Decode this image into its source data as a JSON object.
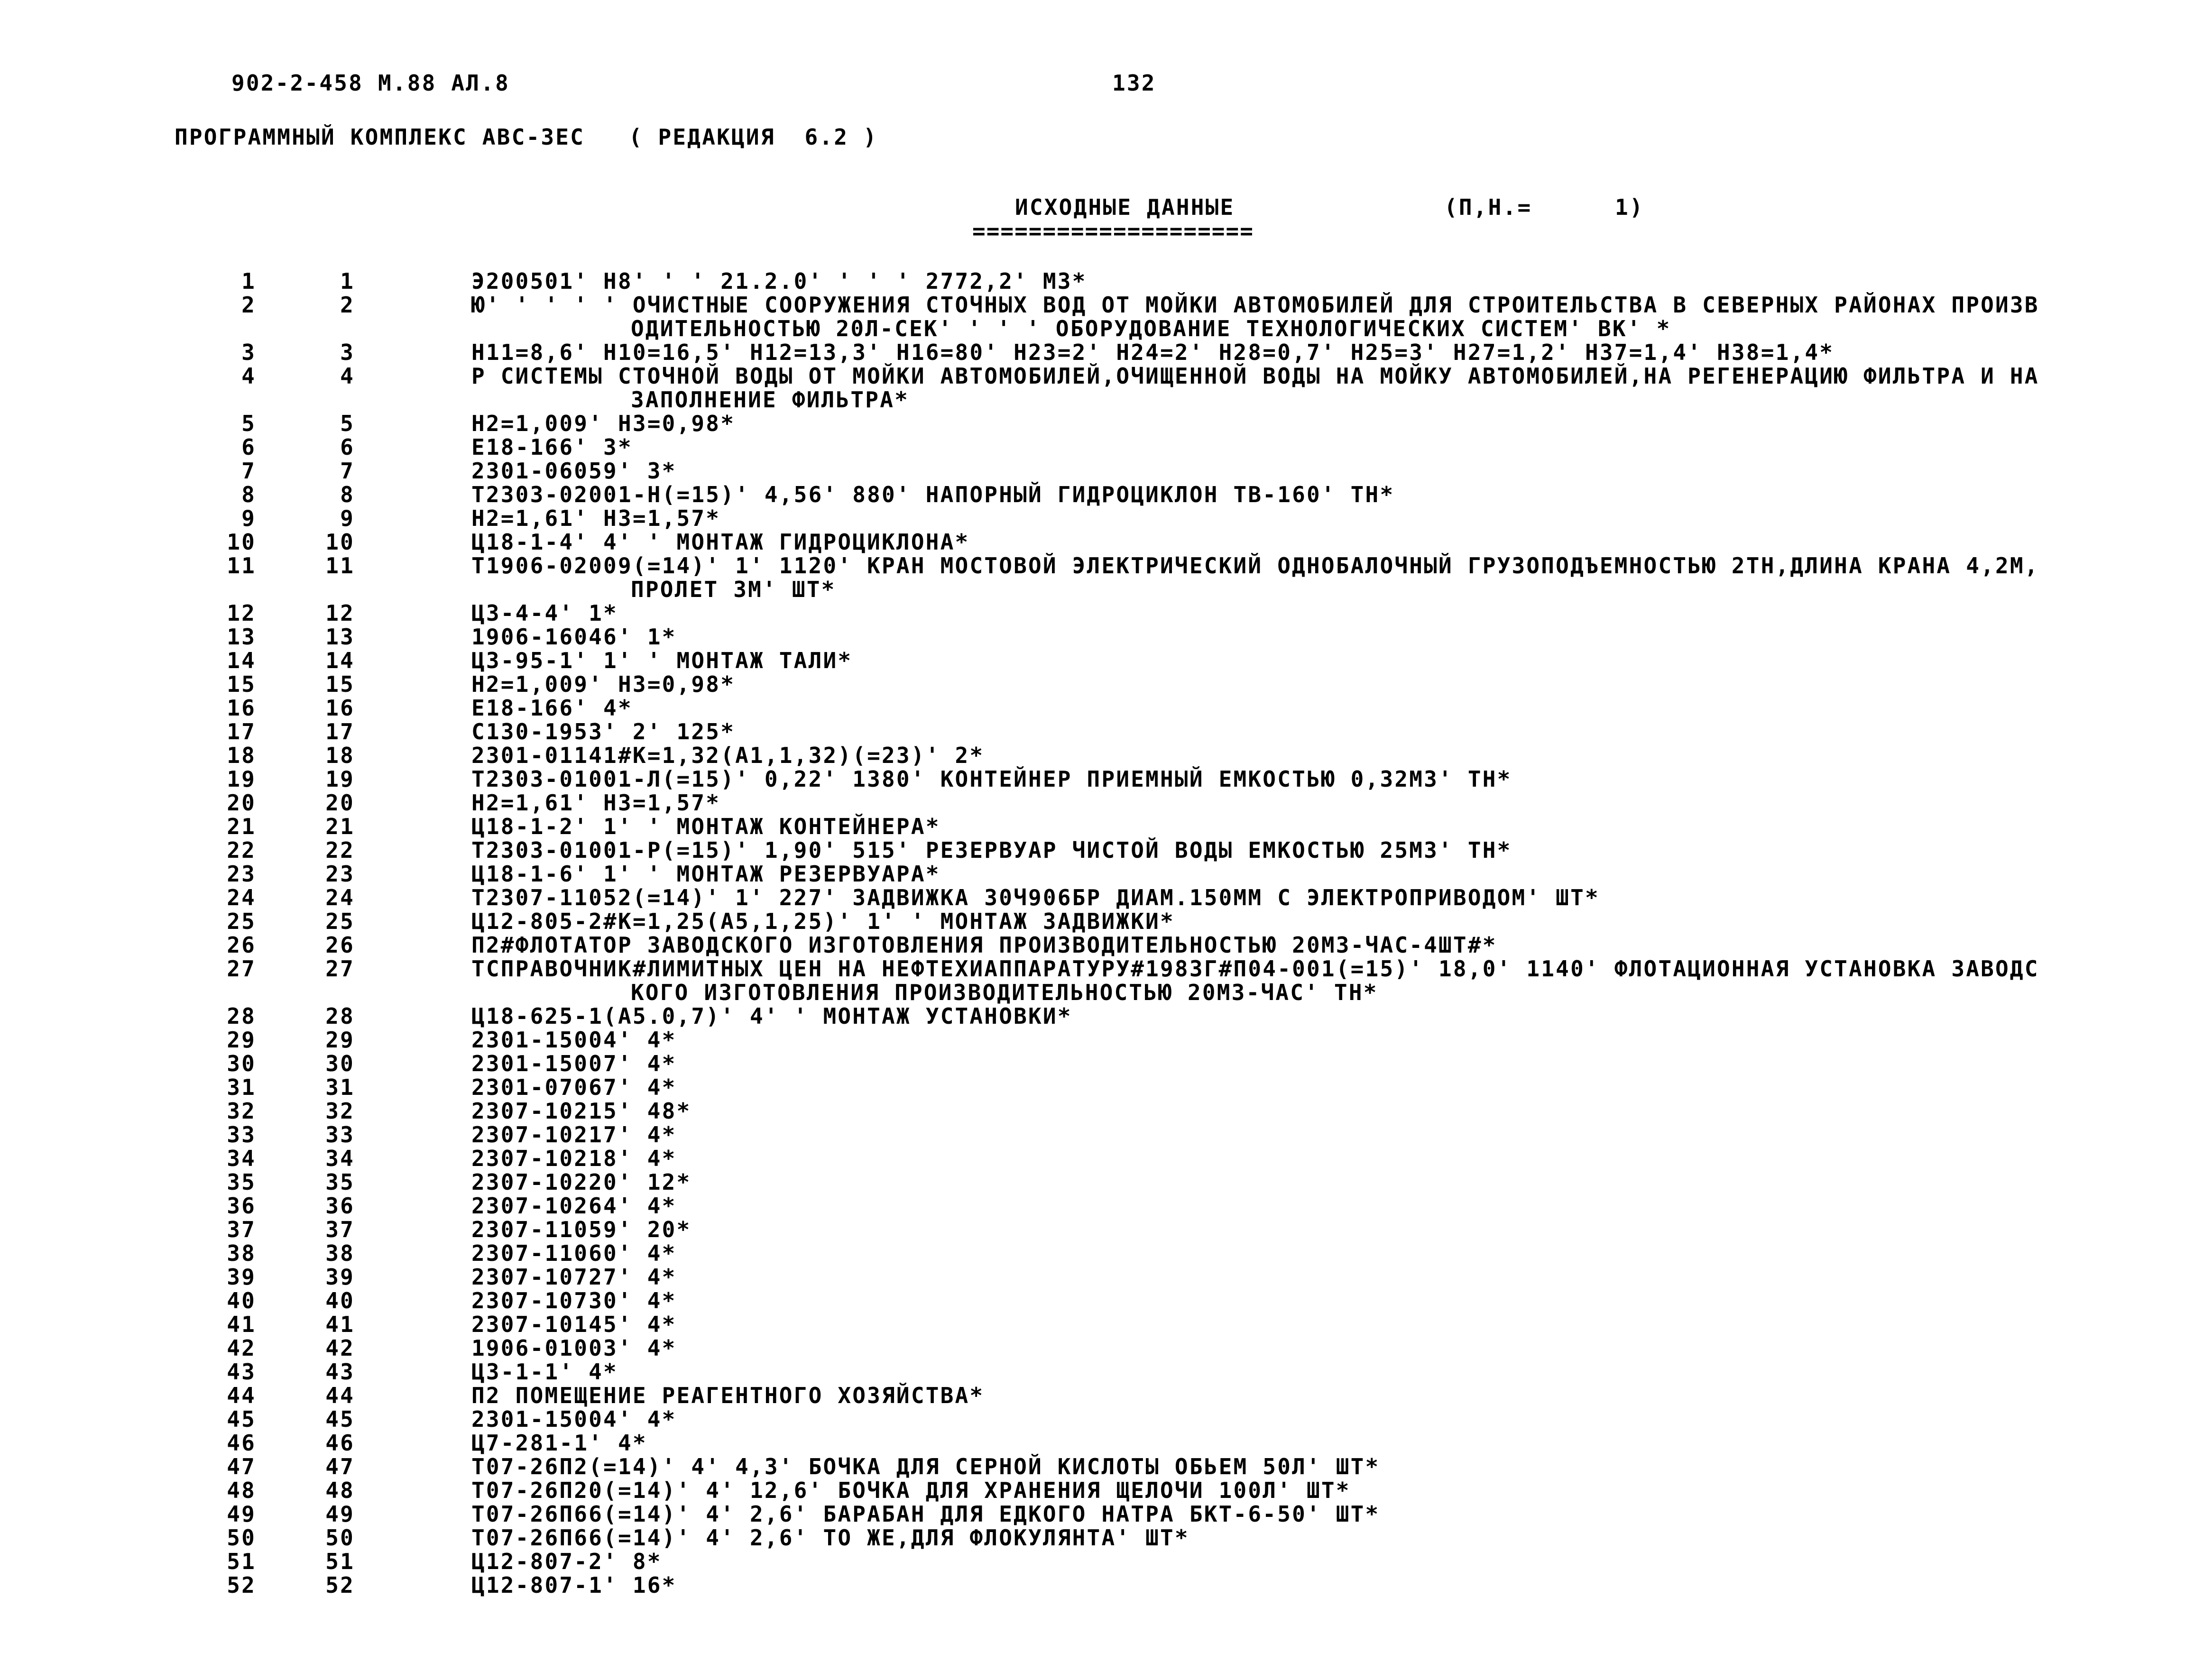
{
  "header": {
    "doc_code": "902-2-458 М.88 АЛ.8",
    "page_number": "132",
    "program_title": "ПРОГРАММНЫЙ КОМПЛЕКС АВС-3ЕС   ( РЕДАКЦИЯ  6.2 )",
    "section_title": "ИСХОДНЫЕ ДАННЫЕ",
    "pn_label": "(П,Н.=",
    "pn_value": "1)",
    "underline": "===================="
  },
  "rows": [
    {
      "n1": "1",
      "n2": "1",
      "text": "Э200501' Н8' ' ' 21.2.0' ' ' ' 2772,2' М3*",
      "cont": ""
    },
    {
      "n1": "2",
      "n2": "2",
      "text": "Ю' ' ' ' ' ОЧИСТНЫЕ СООРУЖЕНИЯ СТОЧНЫХ ВОД ОТ МОЙКИ АВТОМОБИЛЕЙ ДЛЯ СТРОИТЕЛЬСТВА В СЕВЕРНЫХ РАЙОНАХ ПРОИЗВ",
      "cont": "ОДИТЕЛЬНОСТЬЮ 20Л-СЕК' ' ' ' ОБОРУДОВАНИЕ ТЕХНОЛОГИЧЕСКИХ СИСТЕМ' ВК' *"
    },
    {
      "n1": "3",
      "n2": "3",
      "text": "Н11=8,6' Н10=16,5' Н12=13,3' Н16=80' Н23=2' Н24=2' Н28=0,7' Н25=3' Н27=1,2' Н37=1,4' Н38=1,4*",
      "cont": ""
    },
    {
      "n1": "4",
      "n2": "4",
      "text": "Р СИСТЕМЫ СТОЧНОЙ ВОДЫ ОТ МОЙКИ АВТОМОБИЛЕЙ,ОЧИЩЕННОЙ ВОДЫ НА МОЙКУ АВТОМОБИЛЕЙ,НА РЕГЕНЕРАЦИЮ ФИЛЬТРА И НА",
      "cont": "ЗАПОЛНЕНИЕ ФИЛЬТРА*"
    },
    {
      "n1": "5",
      "n2": "5",
      "text": "Н2=1,009' Н3=0,98*",
      "cont": ""
    },
    {
      "n1": "6",
      "n2": "6",
      "text": "Е18-166' 3*",
      "cont": ""
    },
    {
      "n1": "7",
      "n2": "7",
      "text": "2301-06059' 3*",
      "cont": ""
    },
    {
      "n1": "8",
      "n2": "8",
      "text": "Т2303-02001-Н(=15)' 4,56' 880' НАПОРНЫЙ ГИДРОЦИКЛОН ТВ-160' ТН*",
      "cont": ""
    },
    {
      "n1": "9",
      "n2": "9",
      "text": "Н2=1,61' Н3=1,57*",
      "cont": ""
    },
    {
      "n1": "10",
      "n2": "10",
      "text": "Ц18-1-4' 4' ' МОНТАЖ ГИДРОЦИКЛОНА*",
      "cont": ""
    },
    {
      "n1": "11",
      "n2": "11",
      "text": "Т1906-02009(=14)' 1' 1120' КРАН МОСТОВОЙ ЭЛЕКТРИЧЕСКИЙ ОДНОБАЛОЧНЫЙ ГРУЗОПОДЪЕМНОСТЬЮ 2ТН,ДЛИНА КРАНА 4,2М,",
      "cont": "ПРОЛЕТ 3М' ШТ*"
    },
    {
      "n1": "12",
      "n2": "12",
      "text": "Ц3-4-4' 1*",
      "cont": ""
    },
    {
      "n1": "13",
      "n2": "13",
      "text": "1906-16046' 1*",
      "cont": ""
    },
    {
      "n1": "14",
      "n2": "14",
      "text": "Ц3-95-1' 1' ' МОНТАЖ ТАЛИ*",
      "cont": ""
    },
    {
      "n1": "15",
      "n2": "15",
      "text": "Н2=1,009' Н3=0,98*",
      "cont": ""
    },
    {
      "n1": "16",
      "n2": "16",
      "text": "Е18-166' 4*",
      "cont": ""
    },
    {
      "n1": "17",
      "n2": "17",
      "text": "С130-1953' 2' 125*",
      "cont": ""
    },
    {
      "n1": "18",
      "n2": "18",
      "text": "2301-01141#К=1,32(А1,1,32)(=23)' 2*",
      "cont": ""
    },
    {
      "n1": "19",
      "n2": "19",
      "text": "Т2303-01001-Л(=15)' 0,22' 1380' КОНТЕЙНЕР ПРИЕМНЫЙ ЕМКОСТЬЮ 0,32М3' ТН*",
      "cont": ""
    },
    {
      "n1": "20",
      "n2": "20",
      "text": "Н2=1,61' Н3=1,57*",
      "cont": ""
    },
    {
      "n1": "21",
      "n2": "21",
      "text": "Ц18-1-2' 1' ' МОНТАЖ КОНТЕЙНЕРА*",
      "cont": ""
    },
    {
      "n1": "22",
      "n2": "22",
      "text": "Т2303-01001-Р(=15)' 1,90' 515' РЕЗЕРВУАР ЧИСТОЙ ВОДЫ ЕМКОСТЬЮ 25М3' ТН*",
      "cont": ""
    },
    {
      "n1": "23",
      "n2": "23",
      "text": "Ц18-1-6' 1' ' МОНТАЖ РЕЗЕРВУАРА*",
      "cont": ""
    },
    {
      "n1": "24",
      "n2": "24",
      "text": "Т2307-11052(=14)' 1' 227' ЗАДВИЖКА 30Ч906БР ДИАМ.150ММ С ЭЛЕКТРОПРИВОДОМ' ШТ*",
      "cont": ""
    },
    {
      "n1": "25",
      "n2": "25",
      "text": "Ц12-805-2#К=1,25(А5,1,25)' 1' ' МОНТАЖ ЗАДВИЖКИ*",
      "cont": ""
    },
    {
      "n1": "26",
      "n2": "26",
      "text": "П2#ФЛОТАТОР ЗАВОДСКОГО ИЗГОТОВЛЕНИЯ ПРОИЗВОДИТЕЛЬНОСТЬЮ 20М3-ЧАС-4ШТ#*",
      "cont": ""
    },
    {
      "n1": "27",
      "n2": "27",
      "text": "ТСПРАВОЧНИК#ЛИМИТНЫХ ЦЕН НА НЕФТЕХИАППАРАТУРУ#1983Г#П04-001(=15)' 18,0' 1140' ФЛОТАЦИОННАЯ УСТАНОВКА ЗАВОДС",
      "cont": "КОГО ИЗГОТОВЛЕНИЯ ПРОИЗВОДИТЕЛЬНОСТЬЮ 20М3-ЧАС' ТН*"
    },
    {
      "n1": "28",
      "n2": "28",
      "text": "Ц18-625-1(А5.0,7)' 4' ' МОНТАЖ УСТАНОВКИ*",
      "cont": ""
    },
    {
      "n1": "29",
      "n2": "29",
      "text": "2301-15004' 4*",
      "cont": ""
    },
    {
      "n1": "30",
      "n2": "30",
      "text": "2301-15007' 4*",
      "cont": ""
    },
    {
      "n1": "31",
      "n2": "31",
      "text": "2301-07067' 4*",
      "cont": ""
    },
    {
      "n1": "32",
      "n2": "32",
      "text": "2307-10215' 48*",
      "cont": ""
    },
    {
      "n1": "33",
      "n2": "33",
      "text": "2307-10217' 4*",
      "cont": ""
    },
    {
      "n1": "34",
      "n2": "34",
      "text": "2307-10218' 4*",
      "cont": ""
    },
    {
      "n1": "35",
      "n2": "35",
      "text": "2307-10220' 12*",
      "cont": ""
    },
    {
      "n1": "36",
      "n2": "36",
      "text": "2307-10264' 4*",
      "cont": ""
    },
    {
      "n1": "37",
      "n2": "37",
      "text": "2307-11059' 20*",
      "cont": ""
    },
    {
      "n1": "38",
      "n2": "38",
      "text": "2307-11060' 4*",
      "cont": ""
    },
    {
      "n1": "39",
      "n2": "39",
      "text": "2307-10727' 4*",
      "cont": ""
    },
    {
      "n1": "40",
      "n2": "40",
      "text": "2307-10730' 4*",
      "cont": ""
    },
    {
      "n1": "41",
      "n2": "41",
      "text": "2307-10145' 4*",
      "cont": ""
    },
    {
      "n1": "42",
      "n2": "42",
      "text": "1906-01003' 4*",
      "cont": ""
    },
    {
      "n1": "43",
      "n2": "43",
      "text": "Ц3-1-1' 4*",
      "cont": ""
    },
    {
      "n1": "44",
      "n2": "44",
      "text": "П2 ПОМЕЩЕНИЕ РЕАГЕНТНОГО ХОЗЯЙСТВА*",
      "cont": ""
    },
    {
      "n1": "45",
      "n2": "45",
      "text": "2301-15004' 4*",
      "cont": ""
    },
    {
      "n1": "46",
      "n2": "46",
      "text": "Ц7-281-1' 4*",
      "cont": ""
    },
    {
      "n1": "47",
      "n2": "47",
      "text": "Т07-26П2(=14)' 4' 4,3' БОЧКА ДЛЯ СЕРНОЙ КИСЛОТЫ ОБЬЕМ 50Л' ШТ*",
      "cont": ""
    },
    {
      "n1": "48",
      "n2": "48",
      "text": "Т07-26П20(=14)' 4' 12,6' БОЧКА ДЛЯ ХРАНЕНИЯ ЩЕЛОЧИ 100Л' ШТ*",
      "cont": ""
    },
    {
      "n1": "49",
      "n2": "49",
      "text": "Т07-26П66(=14)' 4' 2,6' БАРАБАН ДЛЯ ЕДКОГО НАТРА БКТ-6-50' ШТ*",
      "cont": ""
    },
    {
      "n1": "50",
      "n2": "50",
      "text": "Т07-26П66(=14)' 4' 2,6' ТО ЖЕ,ДЛЯ ФЛОКУЛЯНТА' ШТ*",
      "cont": ""
    },
    {
      "n1": "51",
      "n2": "51",
      "text": "Ц12-807-2' 8*",
      "cont": ""
    },
    {
      "n1": "52",
      "n2": "52",
      "text": "Ц12-807-1' 16*",
      "cont": ""
    }
  ]
}
